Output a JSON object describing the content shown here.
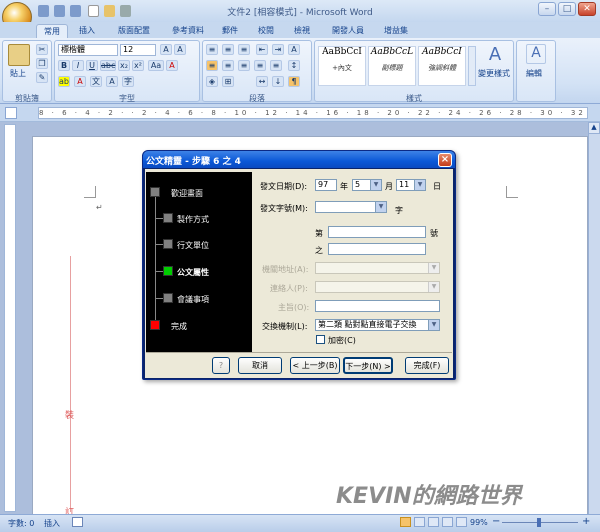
{
  "window": {
    "title": "文件2 [相容模式] - Microsoft Word",
    "minimize": "–",
    "maximize": "□",
    "close": "✕"
  },
  "tabs": [
    "常用",
    "插入",
    "版面配置",
    "參考資料",
    "郵件",
    "校閱",
    "檢視",
    "開發人員",
    "增益集"
  ],
  "ribbon": {
    "clipboard": {
      "label": "剪貼簿",
      "paste": "貼上"
    },
    "font": {
      "label": "字型",
      "name": "標楷體",
      "size": "12",
      "bold": "B",
      "italic": "I",
      "underline": "U",
      "strike": "abc",
      "sub": "x₂",
      "sup": "x²",
      "aa": "Aa",
      "clear": "A"
    },
    "paragraph": {
      "label": "段落"
    },
    "styles": {
      "label": "樣式",
      "items": [
        {
          "sample": "AaBbCcI",
          "caption": "+內文"
        },
        {
          "sample": "AaBbCcL",
          "caption": "副標題"
        },
        {
          "sample": "AaBbCcI",
          "caption": "強調斜體"
        }
      ],
      "change": "變更樣式"
    },
    "editing": {
      "label": "編輯"
    }
  },
  "ruler": {
    "marks": "8 · 6 · 4 · 2 · · 2 · 4 · 6 · 8 · 10 · 12 · 14 · 16 · 18 · 20 · 22 · 24 · 26 · 28 · 30 · 32 · 34 · 36 · 38 · 40 · 42"
  },
  "page": {
    "paragraph_mark": "↵",
    "margin_char_1": "裝",
    "margin_char_2": "訂"
  },
  "status": {
    "words": "字數: 0",
    "mode": "插入",
    "zoom": "99%",
    "minus": "−",
    "plus": "+"
  },
  "watermark": "KEVIN的網路世界",
  "dialog": {
    "title": "公文精靈 - 步驟 6 之 4",
    "steps": [
      {
        "label": "歡迎畫面",
        "color": "#808080"
      },
      {
        "label": "製作方式",
        "color": "#808080"
      },
      {
        "label": "行文單位",
        "color": "#808080"
      },
      {
        "label": "公文屬性",
        "color": "#00cc00",
        "current": true
      },
      {
        "label": "會議事項",
        "color": "#808080"
      },
      {
        "label": "完成",
        "color": "#ff0000"
      }
    ],
    "fields": {
      "date_label": "發文日期(D):",
      "year": "97",
      "year_unit": "年",
      "month": "5",
      "month_unit": "月",
      "day": "11",
      "day_unit": "日",
      "docno_label": "發文字號(M):",
      "docno_value": "",
      "docno_unit": "字",
      "di_label": "第",
      "di_value": "",
      "hao_label": "號",
      "zhi_label": "之",
      "zhi_value": "",
      "addr_label": "機關地址(A):",
      "contact_label": "連絡人(P):",
      "subject_label": "主旨(O):",
      "exchange_label": "交換機制(L):",
      "exchange_value": "第二類 點對點直接電子交換",
      "encrypt_label": "加密(C)"
    },
    "buttons": {
      "help": "?",
      "cancel": "取消",
      "prev": "< 上一步(B)",
      "next": "下一步(N) >",
      "finish": "完成(F)"
    }
  }
}
